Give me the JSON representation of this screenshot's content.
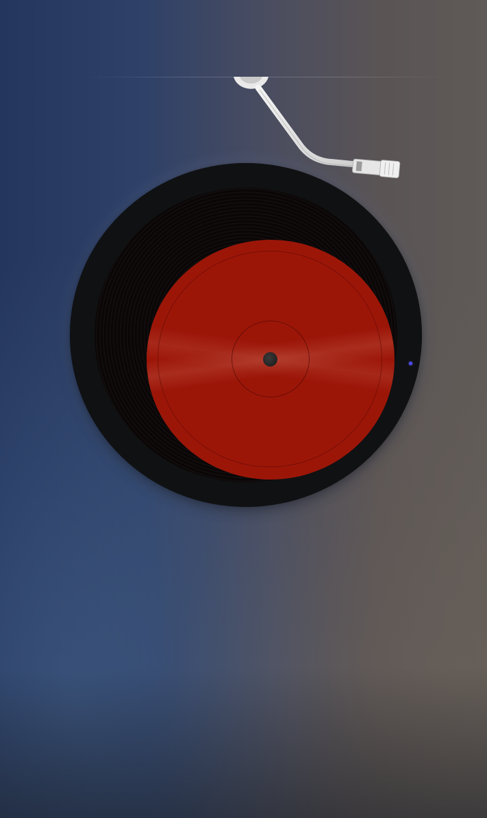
{
  "player": {
    "state": "playing",
    "icon_turntable": "vinyl-record-icon",
    "icon_tonearm": "tonearm-icon"
  },
  "colors": {
    "background_left": "#24365e",
    "background_right": "#5f5a57",
    "record_label": "#9c1608",
    "record_vinyl": "#151315",
    "tonearm": "#e8e8e8",
    "indicator": "#4b4bff"
  }
}
